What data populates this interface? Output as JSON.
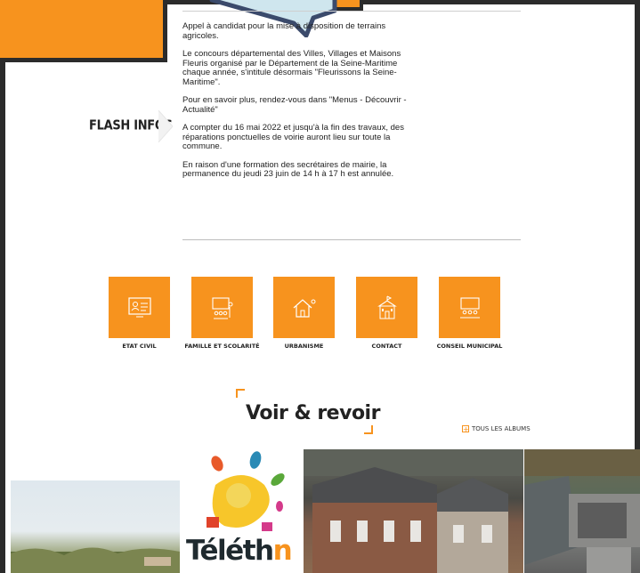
{
  "news": {
    "items": [
      "Appel à candidat       pour la mise à disposition de terrains agricoles.",
      "Le concours départemental des Villes, Villages et Maisons Fleuris organisé par le Département de la Seine-Maritime chaque année, s'intitule désormais \"Fleurissons la Seine-Maritime\".",
      "Pour en savoir plus, rendez-vous dans \"Menus - Découvrir - Actualité\"",
      "A compter du 16 mai 2022 et jusqu'à la fin des travaux, des réparations ponctuelles de voirie auront lieu sur toute la commune.",
      "En raison d'une formation des secrétaires de mairie, la permanence du jeudi 23 juin de 14 h à 17 h est annulée."
    ]
  },
  "flash": {
    "title": "FLASH INFOS"
  },
  "tiles": [
    {
      "label": "ETAT CIVIL",
      "icon": "id-card-icon"
    },
    {
      "label": "FAMILLE ET SCOLARITÉ",
      "icon": "family-icon"
    },
    {
      "label": "URBANISME",
      "icon": "house-icon"
    },
    {
      "label": "CONTACT",
      "icon": "town-hall-icon"
    },
    {
      "label": "CONSEIL MUNICIPAL",
      "icon": "meeting-icon"
    }
  ],
  "gallery": {
    "title": "Voir & revoir",
    "all_albums": "TOUS LES ALBUMS",
    "telethon_text": "Téléth",
    "telethon_tail": "n"
  },
  "colors": {
    "accent": "#f7931e",
    "frame": "#2b2b2b"
  }
}
